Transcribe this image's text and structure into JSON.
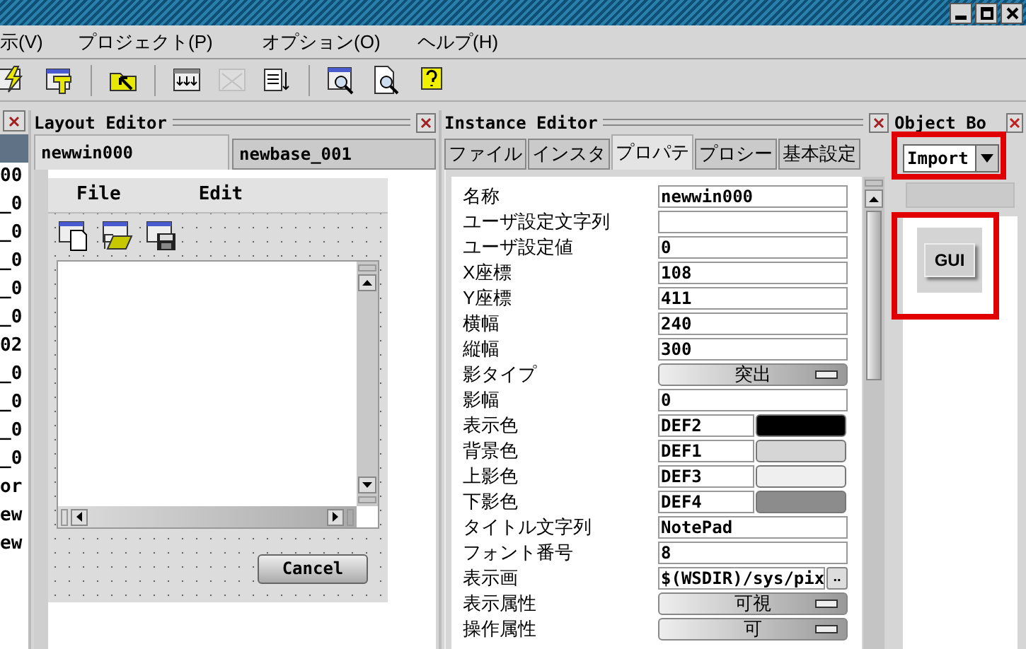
{
  "menu": [
    {
      "label": "示(V)"
    },
    {
      "label": "プロジェクト(P)"
    },
    {
      "label": "オプション(O)"
    },
    {
      "label": "ヘルプ(H)"
    }
  ],
  "toolbar": [
    {
      "disabled": false
    },
    {
      "disabled": false
    },
    {
      "disabled": false
    },
    {
      "disabled": false
    },
    {
      "disabled": true
    },
    {
      "disabled": false
    },
    {
      "disabled": false
    },
    {
      "disabled": false
    },
    {
      "disabled": false
    }
  ],
  "object_list": {
    "items": [
      {
        "selected": true
      },
      {
        "label": "00",
        "selected": false
      },
      {
        "label": "_0",
        "selected": false
      },
      {
        "label": "_0",
        "selected": false
      },
      {
        "label": "_0",
        "selected": false
      },
      {
        "label": "_0",
        "selected": false
      },
      {
        "label": "_0",
        "selected": false
      },
      {
        "label": "02",
        "selected": false
      },
      {
        "label": "_0",
        "selected": false
      },
      {
        "label": "_0",
        "selected": false
      },
      {
        "label": "_0",
        "selected": false
      },
      {
        "label": "_0",
        "selected": false
      },
      {
        "label": "or",
        "selected": false
      },
      {
        "label": "ew",
        "selected": false
      },
      {
        "label": "ew",
        "selected": false
      }
    ]
  },
  "layout_editor": {
    "title": "Layout Editor",
    "tabs": [
      {
        "label": "newwin000",
        "selected": true
      },
      {
        "label": "newbase_001",
        "selected": false
      }
    ],
    "preview": {
      "menu": [
        "File",
        "Edit"
      ],
      "button": "Cancel"
    }
  },
  "instance_editor": {
    "title": "Instance Editor",
    "tabs": [
      {
        "label": "ファイル",
        "selected": false
      },
      {
        "label": "インスタ",
        "selected": false
      },
      {
        "label": "プロパテ",
        "selected": true
      },
      {
        "label": "プロシー",
        "selected": false
      },
      {
        "label": "基本設定",
        "selected": false
      }
    ],
    "properties": [
      {
        "label": "名称",
        "kind": "text",
        "value": "newwin000"
      },
      {
        "label": "ユーザ設定文字列",
        "kind": "text"
      },
      {
        "label": "ユーザ設定値",
        "kind": "text",
        "value": "0"
      },
      {
        "label": "X座標",
        "kind": "text",
        "value": "108"
      },
      {
        "label": "Y座標",
        "kind": "text",
        "value": "411"
      },
      {
        "label": "横幅",
        "kind": "text",
        "value": "240"
      },
      {
        "label": "縦幅",
        "kind": "text",
        "value": "300"
      },
      {
        "label": "影タイプ",
        "kind": "dropdown",
        "value": "突出"
      },
      {
        "label": "影幅",
        "kind": "text",
        "value": "0"
      },
      {
        "label": "表示色",
        "kind": "color",
        "value": "DEF2",
        "color": "#000000"
      },
      {
        "label": "背景色",
        "kind": "color",
        "value": "DEF1",
        "color": "#d6d6d6"
      },
      {
        "label": "上影色",
        "kind": "color",
        "value": "DEF3",
        "color": "#efefef"
      },
      {
        "label": "下影色",
        "kind": "color",
        "value": "DEF4",
        "color": "#8c8c8c"
      },
      {
        "label": "タイトル文字列",
        "kind": "text",
        "value": "NotePad"
      },
      {
        "label": "フォント番号",
        "kind": "text",
        "value": "8"
      },
      {
        "label": "表示画",
        "kind": "file",
        "value": "$(WSDIR)/sys/pix",
        "button": ".."
      },
      {
        "label": "表示属性",
        "kind": "dropdown",
        "value": "可視"
      },
      {
        "label": "操作属性",
        "kind": "dropdown",
        "value": "可"
      }
    ]
  },
  "object_box": {
    "title": "Object Bo",
    "dropdown": {
      "value": "Import"
    },
    "items": [
      {
        "label": "GUI"
      }
    ]
  }
}
